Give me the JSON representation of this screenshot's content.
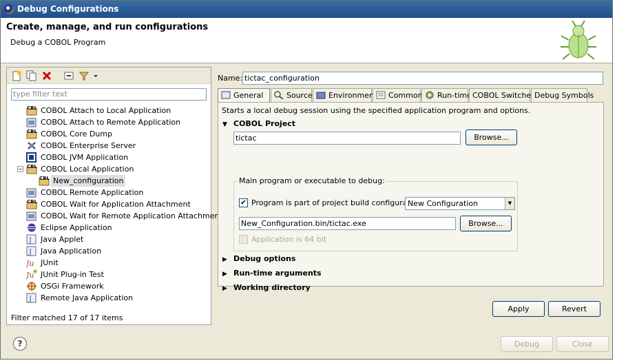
{
  "window": {
    "title": "Debug Configurations"
  },
  "header": {
    "title": "Create, manage, and run configurations",
    "subtitle": "Debug a COBOL Program"
  },
  "left": {
    "filter_placeholder": "type filter text",
    "items": [
      {
        "label": "COBOL Attach to Local Application",
        "icon": "cbl-icon"
      },
      {
        "label": "COBOL Attach to Remote Application",
        "icon": "cbl-remote-icon"
      },
      {
        "label": "COBOL Core Dump",
        "icon": "cbl-icon"
      },
      {
        "label": "COBOL Enterprise Server",
        "icon": "server-icon"
      },
      {
        "label": "COBOL JVM Application",
        "icon": "jvm-icon"
      },
      {
        "label": "COBOL Local Application",
        "icon": "cbl-icon"
      },
      {
        "label": "New_configuration",
        "icon": "cbl-icon"
      },
      {
        "label": "COBOL Remote Application",
        "icon": "cbl-remote-icon"
      },
      {
        "label": "COBOL Wait for Application Attachment",
        "icon": "cbl-icon"
      },
      {
        "label": "COBOL Wait for Remote Application Attachment",
        "icon": "cbl-remote-icon"
      },
      {
        "label": "Eclipse Application",
        "icon": "eclipse-icon"
      },
      {
        "label": "Java Applet",
        "icon": "java-applet-icon"
      },
      {
        "label": "Java Application",
        "icon": "java-app-icon"
      },
      {
        "label": "JUnit",
        "icon": "junit-icon"
      },
      {
        "label": "JUnit Plug-in Test",
        "icon": "junit-plugin-icon"
      },
      {
        "label": "OSGi Framework",
        "icon": "osgi-icon"
      },
      {
        "label": "Remote Java Application",
        "icon": "remote-java-icon"
      }
    ],
    "status": "Filter matched 17 of 17 items",
    "cbl_text": "CBL"
  },
  "right": {
    "name_label": "Name:",
    "name_value": "tictac_configuration",
    "tabs": [
      {
        "label": "General"
      },
      {
        "label": "Source"
      },
      {
        "label": "Environment"
      },
      {
        "label": "Common"
      },
      {
        "label": "Run-time"
      },
      {
        "label": "COBOL Switches"
      },
      {
        "label": "Debug Symbols"
      }
    ],
    "description": "Starts a local debug session using the specified application program and options.",
    "cobol_project": {
      "title": "COBOL Project",
      "value": "tictac",
      "browse": "Browse..."
    },
    "main_program": {
      "title": "Main program or executable to debug:",
      "checkbox_label": "Program is part of project build configuration:",
      "build_config": "New Configuration",
      "path": "New_Configuration.bin/tictac.exe",
      "browse": "Browse...",
      "is64_label": "Application is 64 bit"
    },
    "sections": [
      {
        "label": "Debug options"
      },
      {
        "label": "Run-time arguments"
      },
      {
        "label": "Working directory"
      }
    ],
    "apply": "Apply",
    "revert": "Revert"
  },
  "footer": {
    "debug": "Debug",
    "close": "Close",
    "help": "?"
  }
}
